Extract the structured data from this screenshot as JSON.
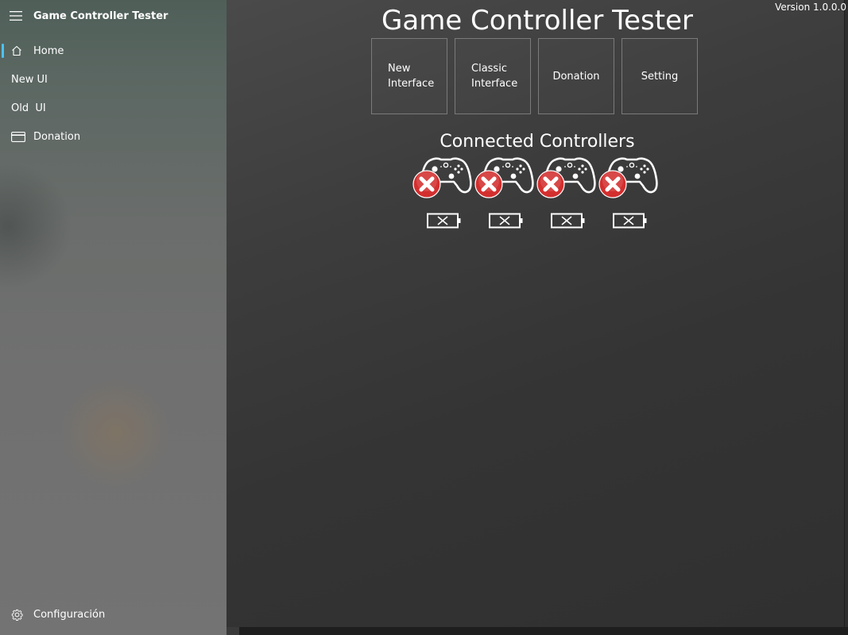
{
  "header": {
    "app_title": "Game Controller Tester",
    "menu_icon": "hamburger-icon"
  },
  "nav": {
    "items": [
      {
        "label": "Home",
        "icon": "home-icon",
        "selected": true
      },
      {
        "label": "New UI",
        "icon": null
      },
      {
        "label": "Old  UI",
        "icon": null
      },
      {
        "label": "Donation",
        "icon": "card-icon"
      }
    ],
    "settings": {
      "label": "Configuración",
      "icon": "gear-icon"
    }
  },
  "main": {
    "version": "Version 1.0.0.0",
    "title": "Game Controller Tester",
    "buttons": {
      "new_interface": "New\nInterface",
      "classic_interface": "Classic\nInterface",
      "donation": "Donation",
      "setting": "Setting"
    },
    "connected_title": "Connected Controllers",
    "controllers": [
      {
        "status": "disconnected",
        "battery": "empty"
      },
      {
        "status": "disconnected",
        "battery": "empty"
      },
      {
        "status": "disconnected",
        "battery": "empty"
      },
      {
        "status": "disconnected",
        "battery": "empty"
      }
    ]
  },
  "colors": {
    "accent": "#4cc2ff",
    "error_red": "#d32f2f",
    "sidebar_top": "#4f5f58",
    "content_bg": "#343434"
  }
}
